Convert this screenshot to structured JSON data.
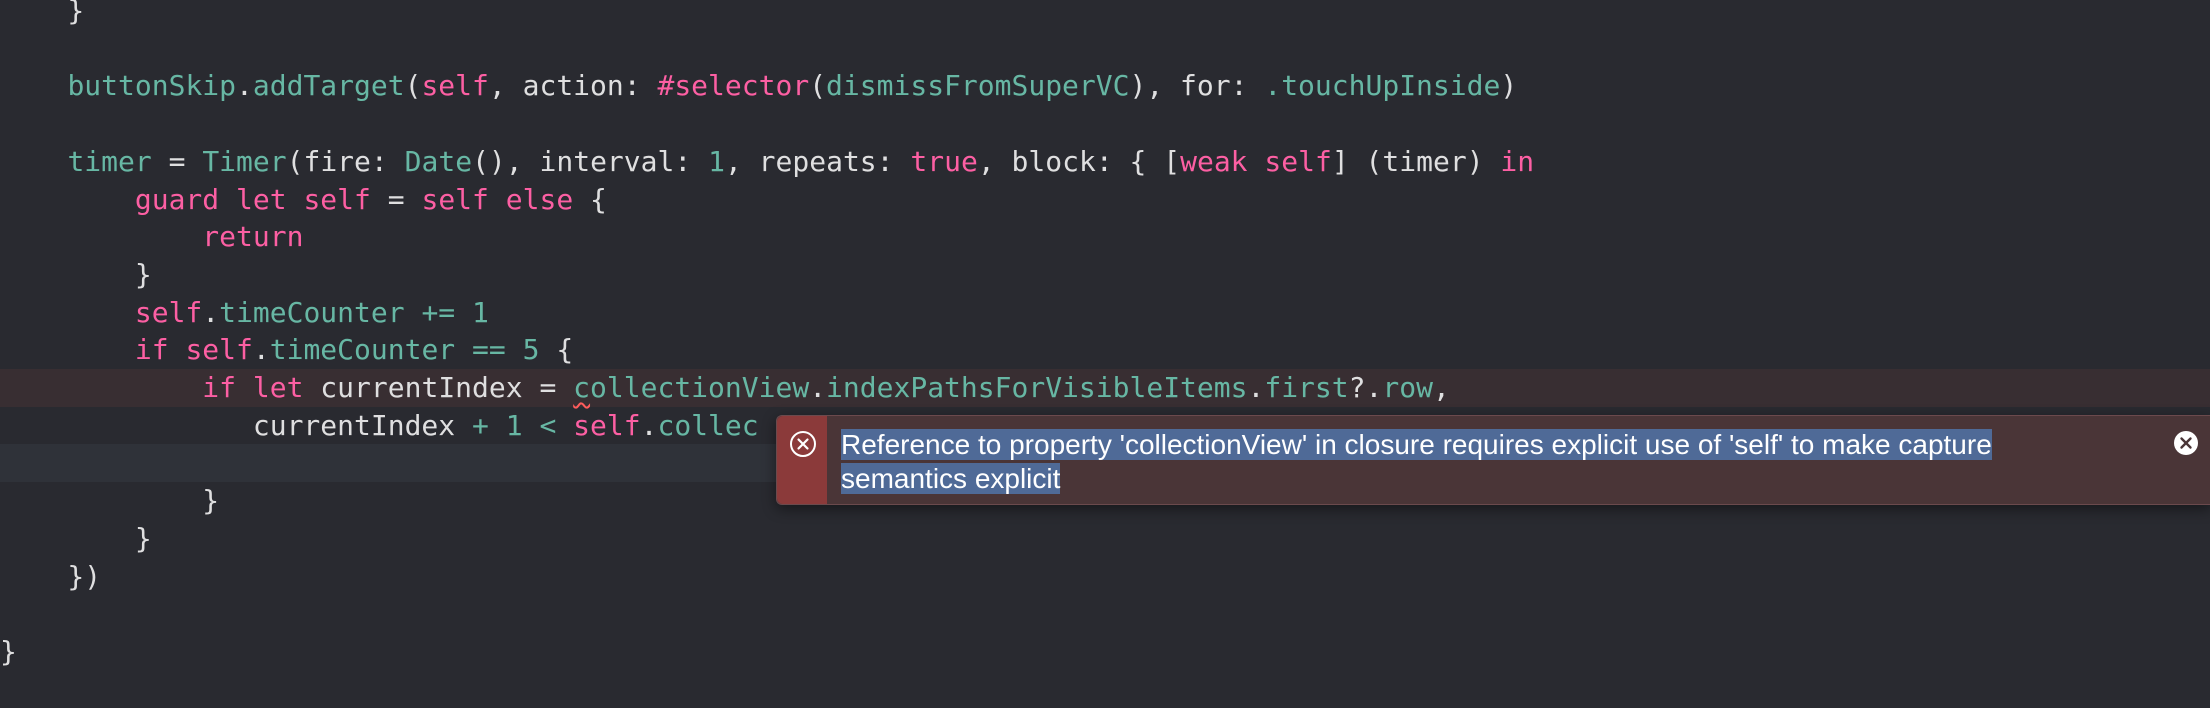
{
  "code_lines": [
    {
      "tokens": [
        {
          "t": "    }",
          "c": "plain"
        }
      ]
    },
    {
      "tokens": []
    },
    {
      "tokens": [
        {
          "t": "    ",
          "c": "plain"
        },
        {
          "t": "buttonSkip",
          "c": "pr"
        },
        {
          "t": ".",
          "c": "plain"
        },
        {
          "t": "addTarget",
          "c": "fn"
        },
        {
          "t": "(",
          "c": "plain"
        },
        {
          "t": "self",
          "c": "kw"
        },
        {
          "t": ", action: ",
          "c": "plain"
        },
        {
          "t": "#selector",
          "c": "kw"
        },
        {
          "t": "(",
          "c": "plain"
        },
        {
          "t": "dismissFromSuperVC",
          "c": "fn"
        },
        {
          "t": "), for: ",
          "c": "plain"
        },
        {
          "t": ".touchUpInside",
          "c": "pr"
        },
        {
          "t": ")",
          "c": "plain"
        }
      ]
    },
    {
      "tokens": []
    },
    {
      "tokens": [
        {
          "t": "    ",
          "c": "plain"
        },
        {
          "t": "timer",
          "c": "pr"
        },
        {
          "t": " = ",
          "c": "plain"
        },
        {
          "t": "Timer",
          "c": "ty"
        },
        {
          "t": "(fire: ",
          "c": "plain"
        },
        {
          "t": "Date",
          "c": "ty"
        },
        {
          "t": "(), interval: ",
          "c": "plain"
        },
        {
          "t": "1",
          "c": "num"
        },
        {
          "t": ", repeats: ",
          "c": "plain"
        },
        {
          "t": "true",
          "c": "kw"
        },
        {
          "t": ", block: { [",
          "c": "plain"
        },
        {
          "t": "weak",
          "c": "kw"
        },
        {
          "t": " ",
          "c": "plain"
        },
        {
          "t": "self",
          "c": "kw"
        },
        {
          "t": "] (timer) ",
          "c": "plain"
        },
        {
          "t": "in",
          "c": "kw"
        }
      ]
    },
    {
      "tokens": [
        {
          "t": "        ",
          "c": "plain"
        },
        {
          "t": "guard",
          "c": "kw"
        },
        {
          "t": " ",
          "c": "plain"
        },
        {
          "t": "let",
          "c": "kw"
        },
        {
          "t": " ",
          "c": "plain"
        },
        {
          "t": "self",
          "c": "kw"
        },
        {
          "t": " = ",
          "c": "plain"
        },
        {
          "t": "self",
          "c": "kw"
        },
        {
          "t": " ",
          "c": "plain"
        },
        {
          "t": "else",
          "c": "kw"
        },
        {
          "t": " {",
          "c": "plain"
        }
      ]
    },
    {
      "tokens": [
        {
          "t": "            ",
          "c": "plain"
        },
        {
          "t": "return",
          "c": "kw"
        }
      ]
    },
    {
      "tokens": [
        {
          "t": "        }",
          "c": "plain"
        }
      ]
    },
    {
      "tokens": [
        {
          "t": "        ",
          "c": "plain"
        },
        {
          "t": "self",
          "c": "kw"
        },
        {
          "t": ".",
          "c": "plain"
        },
        {
          "t": "timeCounter",
          "c": "pr"
        },
        {
          "t": " += ",
          "c": "num"
        },
        {
          "t": "1",
          "c": "num"
        }
      ]
    },
    {
      "tokens": [
        {
          "t": "        ",
          "c": "plain"
        },
        {
          "t": "if",
          "c": "kw"
        },
        {
          "t": " ",
          "c": "plain"
        },
        {
          "t": "self",
          "c": "kw"
        },
        {
          "t": ".",
          "c": "plain"
        },
        {
          "t": "timeCounter",
          "c": "pr"
        },
        {
          "t": " == ",
          "c": "num"
        },
        {
          "t": "5",
          "c": "num"
        },
        {
          "t": " {",
          "c": "plain"
        }
      ]
    },
    {
      "highlight": "error",
      "tokens": [
        {
          "t": "            ",
          "c": "plain"
        },
        {
          "t": "if",
          "c": "kw"
        },
        {
          "t": " ",
          "c": "plain"
        },
        {
          "t": "let",
          "c": "kw"
        },
        {
          "t": " currentIndex = ",
          "c": "plain"
        },
        {
          "t": "c",
          "c": "pr",
          "squiggle": true
        },
        {
          "t": "ollectionView",
          "c": "pr"
        },
        {
          "t": ".",
          "c": "plain"
        },
        {
          "t": "indexPathsForVisibleItems",
          "c": "pr"
        },
        {
          "t": ".",
          "c": "plain"
        },
        {
          "t": "first",
          "c": "pr"
        },
        {
          "t": "?.",
          "c": "plain"
        },
        {
          "t": "row",
          "c": "pr"
        },
        {
          "t": ",",
          "c": "plain"
        }
      ]
    },
    {
      "tokens": [
        {
          "t": "               currentIndex ",
          "c": "plain"
        },
        {
          "t": "+ 1 <",
          "c": "num"
        },
        {
          "t": " ",
          "c": "plain"
        },
        {
          "t": "self",
          "c": "kw"
        },
        {
          "t": ".",
          "c": "plain"
        },
        {
          "t": "collec",
          "c": "pr"
        }
      ]
    },
    {
      "highlight": "cursor",
      "tokens": []
    },
    {
      "tokens": [
        {
          "t": "            }",
          "c": "plain"
        }
      ]
    },
    {
      "tokens": [
        {
          "t": "        }",
          "c": "plain"
        }
      ]
    },
    {
      "tokens": [
        {
          "t": "    })",
          "c": "plain"
        }
      ]
    },
    {
      "tokens": []
    },
    {
      "tokens": [
        {
          "t": "}",
          "c": "plain"
        }
      ]
    }
  ],
  "error_popup": {
    "icon": "error-x-circle-icon",
    "message_line1": "Reference to property 'collectionView' in closure requires explicit use of 'self' to make capture ",
    "message_line2": "semantics explicit",
    "close_icon": "close-icon",
    "gutter_color": "#8b3a3a",
    "background_color": "#4a3537",
    "selection_color": "#4f6a97"
  },
  "colors": {
    "background": "#292a30",
    "keyword": "#fc5fa3",
    "identifier": "#67b7a4",
    "plain": "#dfdfe0",
    "error_line_highlight": "#382e32",
    "cursor_line_highlight": "#2f3239"
  }
}
